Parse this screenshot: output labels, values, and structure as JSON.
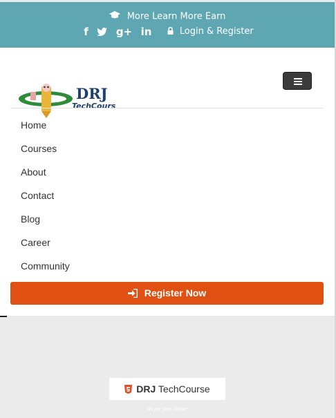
{
  "topbar": {
    "tagline": "More Learn More Earn",
    "login_label": "Login & Register",
    "social": [
      "f",
      "t",
      "g+",
      "in"
    ],
    "cap_icon": "graduation-cap-icon",
    "lock_icon": "lock-icon",
    "background": "#5ea7b2"
  },
  "nav": {
    "toggle_icon": "hamburger-icon",
    "items": [
      "Home",
      "Courses",
      "About",
      "Contact",
      "Blog",
      "Career",
      "Community"
    ],
    "register_label": "Register Now",
    "register_icon": "sign-in-icon",
    "register_color": "#e05012"
  },
  "logo": {
    "text_main": "DRJ",
    "text_sub": "TechCourse"
  },
  "footer": {
    "badge_brand": "DRJ",
    "badge_text": "TechCourse",
    "badge_icon": "html5-icon",
    "note": "As per your choice"
  }
}
